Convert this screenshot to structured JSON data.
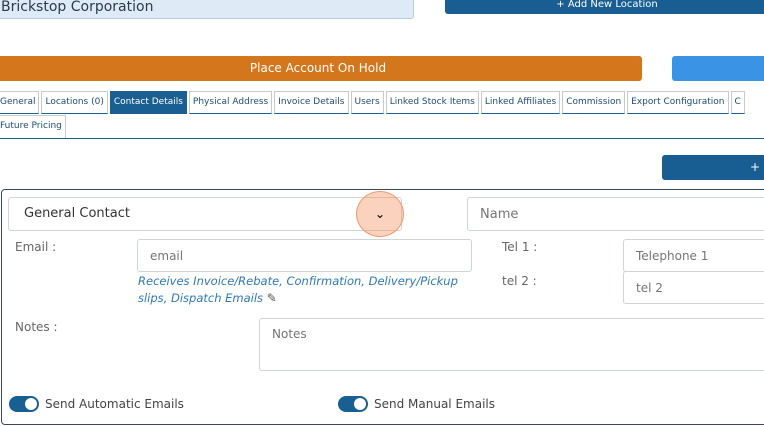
{
  "header": {
    "company_name": "Brickstop Corporation",
    "add_location_label": "+ Add New Location",
    "place_on_hold_label": "Place Account On Hold",
    "right_button_label": "",
    "small_right_button_label": "+"
  },
  "tabs": [
    {
      "label": "General",
      "active": false
    },
    {
      "label": "Locations (0)",
      "active": false
    },
    {
      "label": "Contact Details",
      "active": true
    },
    {
      "label": "Physical Address",
      "active": false
    },
    {
      "label": "Invoice Details",
      "active": false
    },
    {
      "label": "Users",
      "active": false
    },
    {
      "label": "Linked Stock Items",
      "active": false
    },
    {
      "label": "Linked Affiliates",
      "active": false
    },
    {
      "label": "Commission",
      "active": false
    },
    {
      "label": "Export Configuration",
      "active": false
    },
    {
      "label": "C",
      "active": false
    }
  ],
  "tab_row2": {
    "label": "Future Pricing"
  },
  "contact": {
    "type_selected": "General Contact",
    "name_placeholder": "Name",
    "email_label": "Email :",
    "email_placeholder": "email",
    "email_note": "Receives Invoice/Rebate, Confirmation, Delivery/Pickup slips, Dispatch Emails",
    "tel1_label": "Tel 1 :",
    "tel1_placeholder": "Telephone 1",
    "tel2_label": "tel 2 :",
    "tel2_placeholder": "tel 2",
    "notes_label": "Notes :",
    "notes_placeholder": "Notes",
    "auto_emails_label": "Send Automatic Emails",
    "manual_emails_label": "Send Manual Emails"
  },
  "colors": {
    "primary": "#1a5f91",
    "hold": "#d4761b",
    "accent_blue": "#3b93e6",
    "link": "#2f78b5"
  }
}
